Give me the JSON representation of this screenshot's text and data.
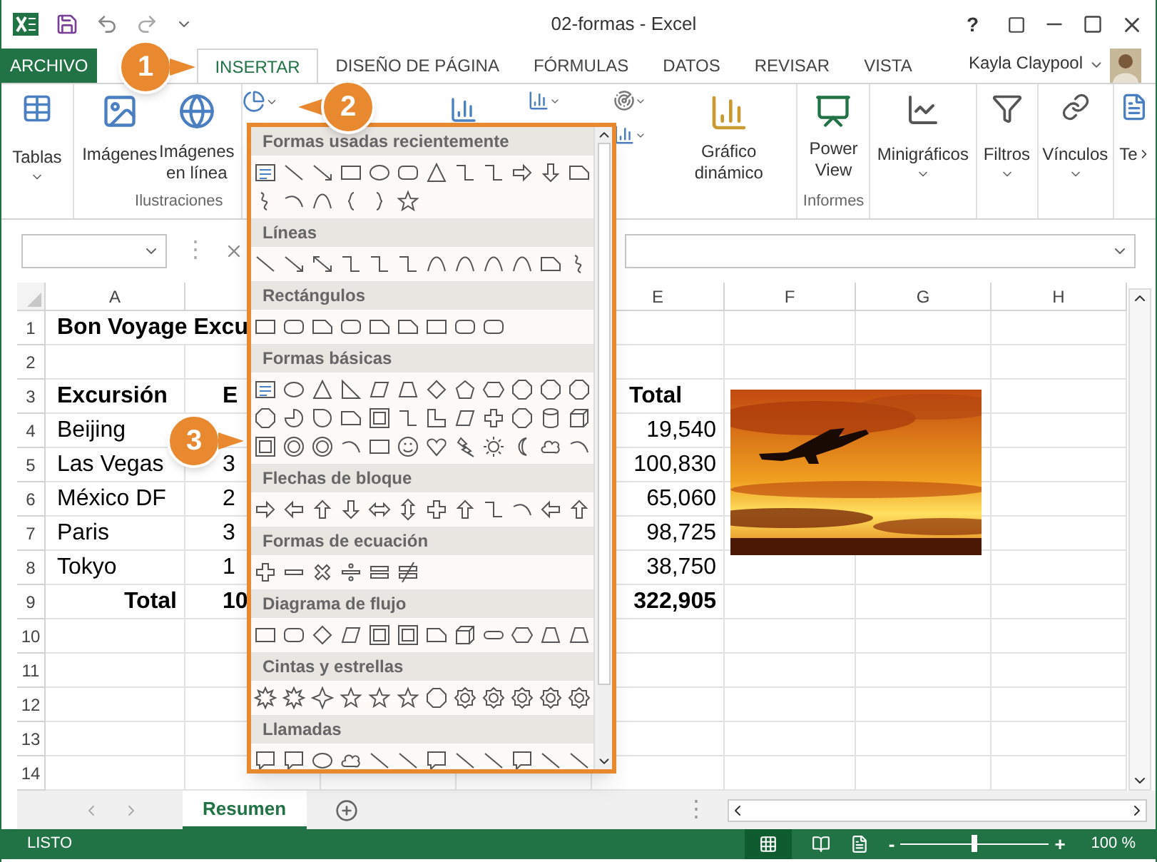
{
  "title_bar": {
    "title": "02-formas - Excel",
    "help": "?"
  },
  "ribbon_tabs": [
    {
      "label": "ARCHIVO",
      "kind": "file",
      "selected": false
    },
    {
      "label": "INSERTAR",
      "kind": "tab",
      "selected": true
    },
    {
      "label": "DISEÑO DE PÁGINA",
      "kind": "tab",
      "selected": false
    },
    {
      "label": "FÓRMULAS",
      "kind": "tab",
      "selected": false
    },
    {
      "label": "DATOS",
      "kind": "tab",
      "selected": false
    },
    {
      "label": "REVISAR",
      "kind": "tab",
      "selected": false
    },
    {
      "label": "VISTA",
      "kind": "tab",
      "selected": false
    }
  ],
  "user": {
    "name": "Kayla Claypool"
  },
  "ribbon": {
    "tables": "Tablas",
    "pictures": "Imágenes",
    "online_pictures": "Imágenes en línea",
    "illustrations_group": "Ilustraciones",
    "pivot_chart": "Gráfico dinámico",
    "power_view": "Power View",
    "reports_group": "Informes",
    "sparklines": "Minigráficos",
    "filters": "Filtros",
    "links": "Vínculos",
    "text_cut": "Te"
  },
  "formula_bar": {
    "separator": "⋮"
  },
  "shapes_gallery": {
    "sections": [
      {
        "title": "Formas usadas recientemente"
      },
      {
        "title": "Líneas"
      },
      {
        "title": "Rectángulos"
      },
      {
        "title": "Formas básicas"
      },
      {
        "title": "Flechas de bloque"
      },
      {
        "title": "Formas de ecuación"
      },
      {
        "title": "Diagrama de flujo"
      },
      {
        "title": "Cintas y estrellas"
      },
      {
        "title": "Llamadas"
      }
    ]
  },
  "callouts": [
    {
      "number": "1"
    },
    {
      "number": "2"
    },
    {
      "number": "3"
    }
  ],
  "sheet": {
    "column_headers": {
      "A": "A",
      "E": "E",
      "F": "F",
      "G": "G",
      "H": "H"
    },
    "rows": [
      {
        "number": "1",
        "bold": true,
        "cells": {
          "A": {
            "text": "Bon Voyage Excu"
          }
        }
      },
      {
        "number": "2",
        "cells": {}
      },
      {
        "number": "3",
        "bold": true,
        "cells": {
          "A": {
            "text": "Excursión"
          },
          "B": {
            "text": "E"
          },
          "E": {
            "text": "Total"
          }
        }
      },
      {
        "number": "4",
        "bold": false,
        "cells": {
          "A": {
            "text": "Beijing"
          },
          "E": {
            "text": "19,540",
            "right_aligned": true
          }
        }
      },
      {
        "number": "5",
        "bold": false,
        "cells": {
          "A": {
            "text": "Las Vegas"
          },
          "B": {
            "text": "3"
          },
          "E": {
            "text": "100,830",
            "right_aligned": true
          }
        }
      },
      {
        "number": "6",
        "bold": false,
        "cells": {
          "A": {
            "text": "México DF"
          },
          "B": {
            "text": "2"
          },
          "E": {
            "text": "65,060",
            "right_aligned": true
          }
        }
      },
      {
        "number": "7",
        "bold": false,
        "cells": {
          "A": {
            "text": "Paris"
          },
          "B": {
            "text": "3"
          },
          "E": {
            "text": "98,725",
            "right_aligned": true
          }
        }
      },
      {
        "number": "8",
        "bold": false,
        "cells": {
          "A": {
            "text": "Tokyo"
          },
          "B": {
            "text": "1"
          },
          "E": {
            "text": "38,750",
            "right_aligned": true
          }
        }
      },
      {
        "number": "9",
        "bold": true,
        "cells": {
          "A": {
            "text": "Total",
            "right_aligned": true
          },
          "B": {
            "text": "10"
          },
          "E": {
            "text": "322,905",
            "right_aligned": true
          }
        }
      },
      {
        "number": "10",
        "cells": {}
      },
      {
        "number": "11",
        "cells": {}
      },
      {
        "number": "12",
        "cells": {}
      },
      {
        "number": "13",
        "cells": {}
      },
      {
        "number": "14",
        "cells": {}
      }
    ]
  },
  "sheet_tabs": [
    {
      "label": "Resumen",
      "selected": true
    }
  ],
  "sheet_bar": {
    "separator": "⋮"
  },
  "status_bar": {
    "status": "LISTO",
    "zoom_out": "-",
    "zoom_in": "+",
    "zoom": "100 %",
    "zoom_level": {
      "level": 0.5
    }
  }
}
